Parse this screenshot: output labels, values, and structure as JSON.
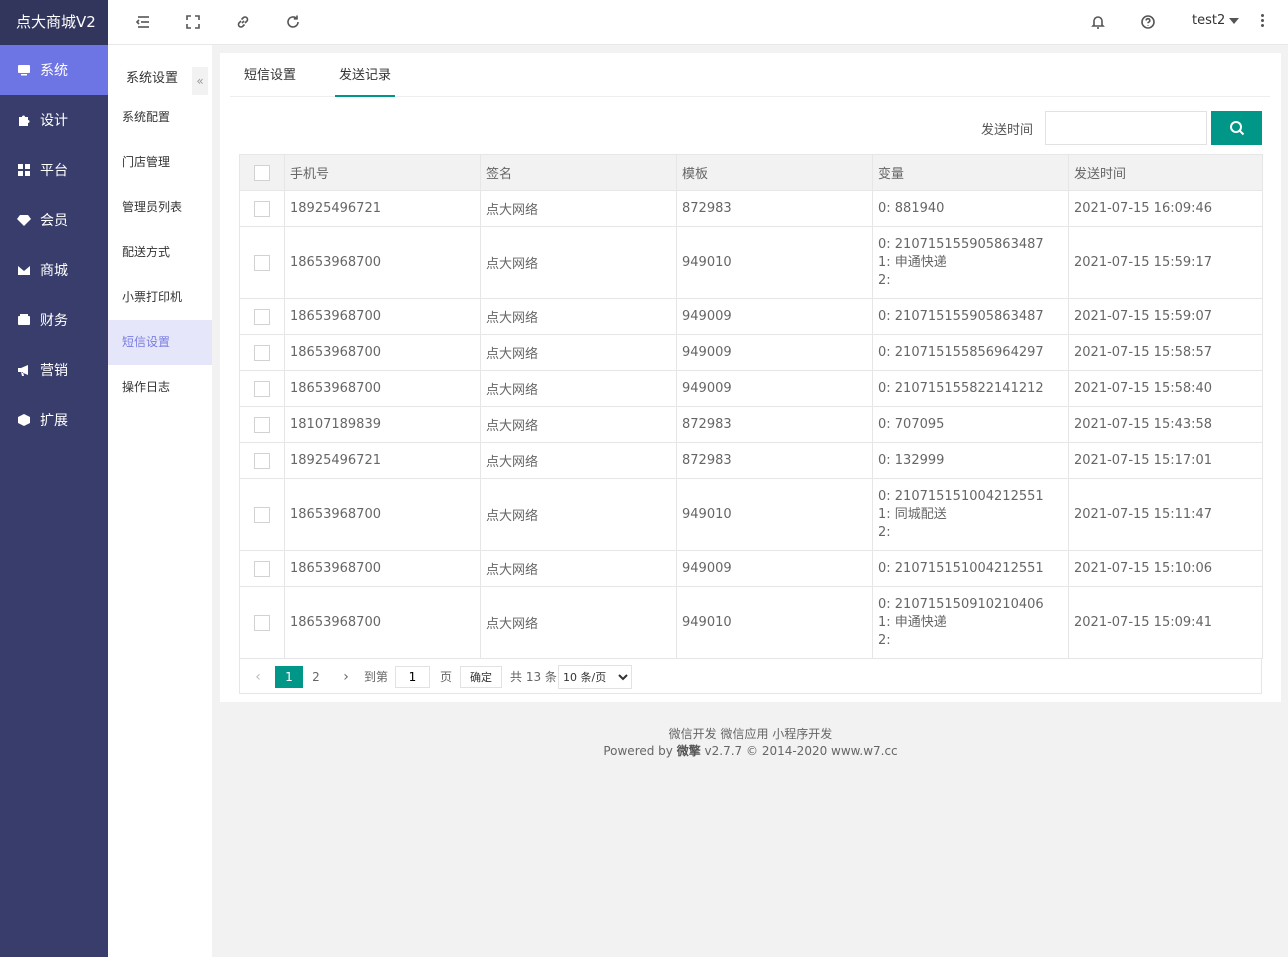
{
  "app": {
    "title": "点大商城V2"
  },
  "sidebar": {
    "items": [
      {
        "label": "系统",
        "icon": "monitor-icon",
        "active": true
      },
      {
        "label": "设计",
        "icon": "puzzle-icon",
        "active": false
      },
      {
        "label": "平台",
        "icon": "grid-icon",
        "active": false
      },
      {
        "label": "会员",
        "icon": "gem-icon",
        "active": false
      },
      {
        "label": "商城",
        "icon": "envelope-icon",
        "active": false
      },
      {
        "label": "财务",
        "icon": "wallet-icon",
        "active": false
      },
      {
        "label": "营销",
        "icon": "megaphone-icon",
        "active": false
      },
      {
        "label": "扩展",
        "icon": "cube-icon",
        "active": false
      }
    ]
  },
  "header": {
    "user": "test2"
  },
  "submenu": {
    "title": "系统设置",
    "collapse_glyph": "«",
    "items": [
      {
        "label": "系统配置",
        "active": false
      },
      {
        "label": "门店管理",
        "active": false
      },
      {
        "label": "管理员列表",
        "active": false
      },
      {
        "label": "配送方式",
        "active": false
      },
      {
        "label": "小票打印机",
        "active": false
      },
      {
        "label": "短信设置",
        "active": true
      },
      {
        "label": "操作日志",
        "active": false
      }
    ]
  },
  "tabs": [
    {
      "label": "短信设置",
      "active": false
    },
    {
      "label": "发送记录",
      "active": true
    }
  ],
  "search": {
    "label": "发送时间",
    "value": ""
  },
  "table": {
    "columns": [
      "手机号",
      "签名",
      "模板",
      "变量",
      "发送时间"
    ],
    "rows": [
      {
        "phone": "18925496721",
        "sign": "点大网络",
        "template": "872983",
        "vars": [
          "0: 881940"
        ],
        "time": "2021-07-15 16:09:46"
      },
      {
        "phone": "18653968700",
        "sign": "点大网络",
        "template": "949010",
        "vars": [
          "0: 210715155905863487",
          "1: 申通快递",
          "2:"
        ],
        "time": "2021-07-15 15:59:17"
      },
      {
        "phone": "18653968700",
        "sign": "点大网络",
        "template": "949009",
        "vars": [
          "0: 210715155905863487"
        ],
        "time": "2021-07-15 15:59:07"
      },
      {
        "phone": "18653968700",
        "sign": "点大网络",
        "template": "949009",
        "vars": [
          "0: 210715155856964297"
        ],
        "time": "2021-07-15 15:58:57"
      },
      {
        "phone": "18653968700",
        "sign": "点大网络",
        "template": "949009",
        "vars": [
          "0: 210715155822141212"
        ],
        "time": "2021-07-15 15:58:40"
      },
      {
        "phone": "18107189839",
        "sign": "点大网络",
        "template": "872983",
        "vars": [
          "0: 707095"
        ],
        "time": "2021-07-15 15:43:58"
      },
      {
        "phone": "18925496721",
        "sign": "点大网络",
        "template": "872983",
        "vars": [
          "0: 132999"
        ],
        "time": "2021-07-15 15:17:01"
      },
      {
        "phone": "18653968700",
        "sign": "点大网络",
        "template": "949010",
        "vars": [
          "0: 210715151004212551",
          "1: 同城配送",
          "2:"
        ],
        "time": "2021-07-15 15:11:47"
      },
      {
        "phone": "18653968700",
        "sign": "点大网络",
        "template": "949009",
        "vars": [
          "0: 210715151004212551"
        ],
        "time": "2021-07-15 15:10:06"
      },
      {
        "phone": "18653968700",
        "sign": "点大网络",
        "template": "949010",
        "vars": [
          "0: 210715150910210406",
          "1: 申通快递",
          "2:"
        ],
        "time": "2021-07-15 15:09:41"
      }
    ]
  },
  "pager": {
    "pages": [
      "1",
      "2"
    ],
    "current": "1",
    "goto_label": "到第",
    "goto_value": "1",
    "page_unit": "页",
    "confirm": "确定",
    "total": "共 13 条",
    "page_size": "10 条/页"
  },
  "footer": {
    "links": "微信开发 微信应用 小程序开发",
    "powered_prefix": "Powered by ",
    "powered_brand": "微擎",
    "powered_suffix": " v2.7.7 © 2014-2020 www.w7.cc"
  },
  "colors": {
    "sidebar": "#393d6b",
    "sidebar_active": "#6d74e4",
    "accent": "#009688"
  }
}
